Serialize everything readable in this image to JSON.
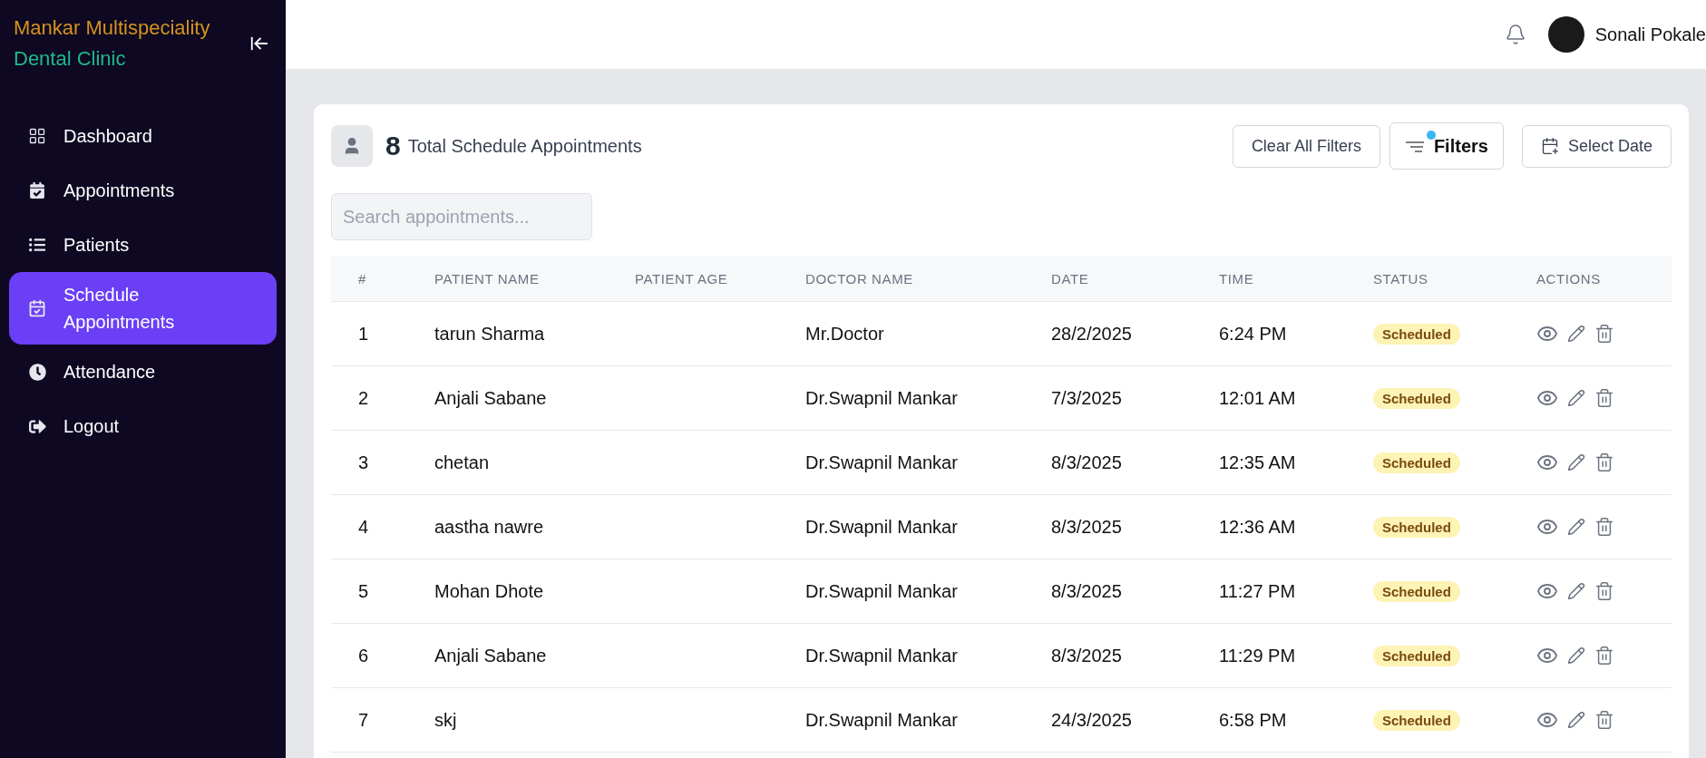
{
  "sidebar": {
    "brand_line_1": "Mankar Multispeciality",
    "brand_line_2": "Dental Clinic",
    "items": [
      {
        "kind": "dashboard",
        "label": "Dashboard",
        "selected": false
      },
      {
        "kind": "appointments",
        "label": "Appointments",
        "selected": false
      },
      {
        "kind": "patients",
        "label": "Patients",
        "selected": false
      },
      {
        "kind": "schedule",
        "label": "Schedule Appointments",
        "selected": true
      },
      {
        "kind": "attendance",
        "label": "Attendance",
        "selected": false
      },
      {
        "kind": "logout",
        "label": "Logout",
        "selected": false
      }
    ]
  },
  "header": {
    "user_name": "Sonali Pokale"
  },
  "summary": {
    "count": "8",
    "label": "Total Schedule Appointments"
  },
  "buttons": {
    "clear": "Clear All Filters",
    "filters": "Filters",
    "filters_active": true,
    "date": "Select Date"
  },
  "search": {
    "placeholder": "Search appointments..."
  },
  "table": {
    "columns": [
      "#",
      "PATIENT NAME",
      "PATIENT AGE",
      "DOCTOR NAME",
      "DATE",
      "TIME",
      "STATUS",
      "ACTIONS"
    ],
    "rows": [
      {
        "num": "1",
        "patient": "tarun Sharma",
        "doctor": "Mr.Doctor",
        "date": "28/2/2025",
        "time": "6:24 PM",
        "status": "Scheduled"
      },
      {
        "num": "2",
        "patient": "Anjali Sabane",
        "doctor": "Dr.Swapnil Mankar",
        "date": "7/3/2025",
        "time": "12:01 AM",
        "status": "Scheduled"
      },
      {
        "num": "3",
        "patient": "chetan",
        "doctor": "Dr.Swapnil Mankar",
        "date": "8/3/2025",
        "time": "12:35 AM",
        "status": "Scheduled"
      },
      {
        "num": "4",
        "patient": "aastha nawre",
        "doctor": "Dr.Swapnil Mankar",
        "date": "8/3/2025",
        "time": "12:36 AM",
        "status": "Scheduled"
      },
      {
        "num": "5",
        "patient": "Mohan Dhote",
        "doctor": "Dr.Swapnil Mankar",
        "date": "8/3/2025",
        "time": "11:27 PM",
        "status": "Scheduled"
      },
      {
        "num": "6",
        "patient": "Anjali Sabane",
        "doctor": "Dr.Swapnil Mankar",
        "date": "8/3/2025",
        "time": "11:29 PM",
        "status": "Scheduled"
      },
      {
        "num": "7",
        "patient": "skj",
        "doctor": "Dr.Swapnil Mankar",
        "date": "24/3/2025",
        "time": "6:58 PM",
        "status": "Scheduled"
      }
    ]
  }
}
